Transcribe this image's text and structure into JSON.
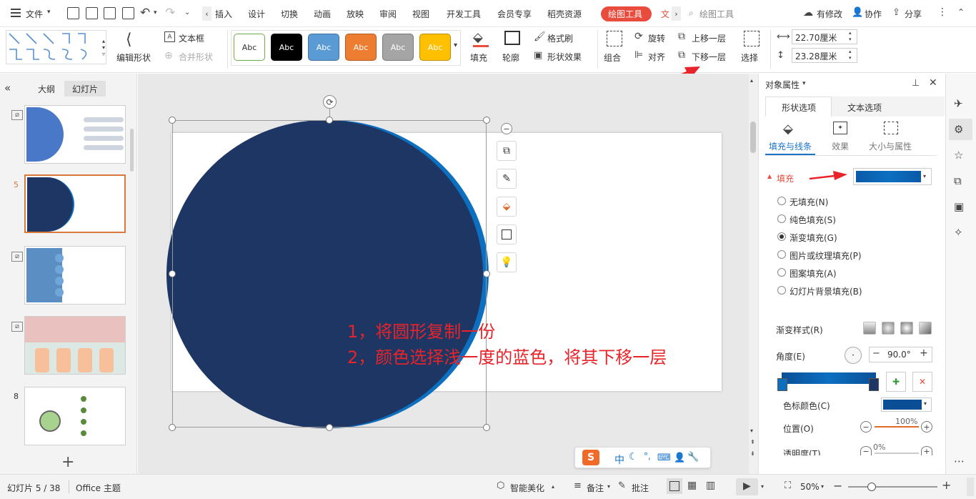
{
  "menubar": {
    "file": "文件",
    "tabs": [
      "插入",
      "设计",
      "切换",
      "动画",
      "放映",
      "审阅",
      "视图",
      "开发工具",
      "会员专享",
      "稻壳资源"
    ],
    "active_tab": "绘图工具",
    "next_tab": "文",
    "search": "绘图工具",
    "changes": "有修改",
    "collab": "协作",
    "share": "分享"
  },
  "ribbon": {
    "edit_shape": "编辑形状",
    "textbox": "文本框",
    "merge_shape": "合并形状",
    "styles": [
      {
        "label": "Abc",
        "bg": "#ffffff",
        "border": "#70ad47",
        "color": "#333333"
      },
      {
        "label": "Abc",
        "bg": "#000000",
        "border": "#000000",
        "color": "#ffffff"
      },
      {
        "label": "Abc",
        "bg": "#5b9bd5",
        "border": "#41719c",
        "color": "#ffffff"
      },
      {
        "label": "Abc",
        "bg": "#ed7d31",
        "border": "#ae5a21",
        "color": "#ffffff"
      },
      {
        "label": "Abc",
        "bg": "#a5a5a5",
        "border": "#787878",
        "color": "#ffffff"
      },
      {
        "label": "Abc",
        "bg": "#ffc000",
        "border": "#bc8c00",
        "color": "#ffffff"
      }
    ],
    "fill": "填充",
    "outline": "轮廓",
    "format_painter": "格式刷",
    "shape_effect": "形状效果",
    "group": "组合",
    "rotate": "旋转",
    "align": "对齐",
    "bring_forward": "上移一层",
    "send_backward": "下移一层",
    "select": "选择",
    "width": "22.70厘米",
    "height": "23.28厘米"
  },
  "leftpanel": {
    "tab_outline": "大纲",
    "tab_slides": "幻灯片",
    "slides": [
      {
        "num": ""
      },
      {
        "num": "5"
      },
      {
        "num": ""
      },
      {
        "num": ""
      },
      {
        "num": "8"
      }
    ]
  },
  "slide": {
    "line1": "1，将圆形复制一份",
    "line2": "2，颜色选择浅一度的蓝色，将其下移一层",
    "circle_color": "#1e3663",
    "back_circle_color": "#0c6fc0"
  },
  "ime": {
    "lang": "中",
    "moon": "☾",
    "dot": "°,"
  },
  "rpanel": {
    "title": "对象属性",
    "tab_shape": "形状选项",
    "tab_text": "文本选项",
    "sub_fill_line": "填充与线条",
    "sub_effect": "效果",
    "sub_size": "大小与属性",
    "fill_header": "填充",
    "fill_options": [
      "无填充(N)",
      "纯色填充(S)",
      "渐变填充(G)",
      "图片或纹理填充(P)",
      "图案填充(A)",
      "幻灯片背景填充(B)"
    ],
    "selected_fill": 2,
    "gradient_style": "渐变样式(R)",
    "angle_label": "角度(E)",
    "angle_value": "90.0°",
    "stop_color": "色标颜色(C)",
    "position": "位置(O)",
    "position_value": "100%",
    "transparency": "透明度(T)",
    "transparency_value": "0%"
  },
  "statusbar": {
    "slide_info": "幻灯片 5 / 38",
    "theme": "Office 主题",
    "beautify": "智能美化",
    "notes": "备注",
    "comments": "批注",
    "zoom": "50%"
  },
  "colors": {
    "accent_red": "#e94b3c",
    "annotation_red": "#e8242a",
    "selected_border": "#d77a3b",
    "tab_blue": "#1a73c9"
  }
}
